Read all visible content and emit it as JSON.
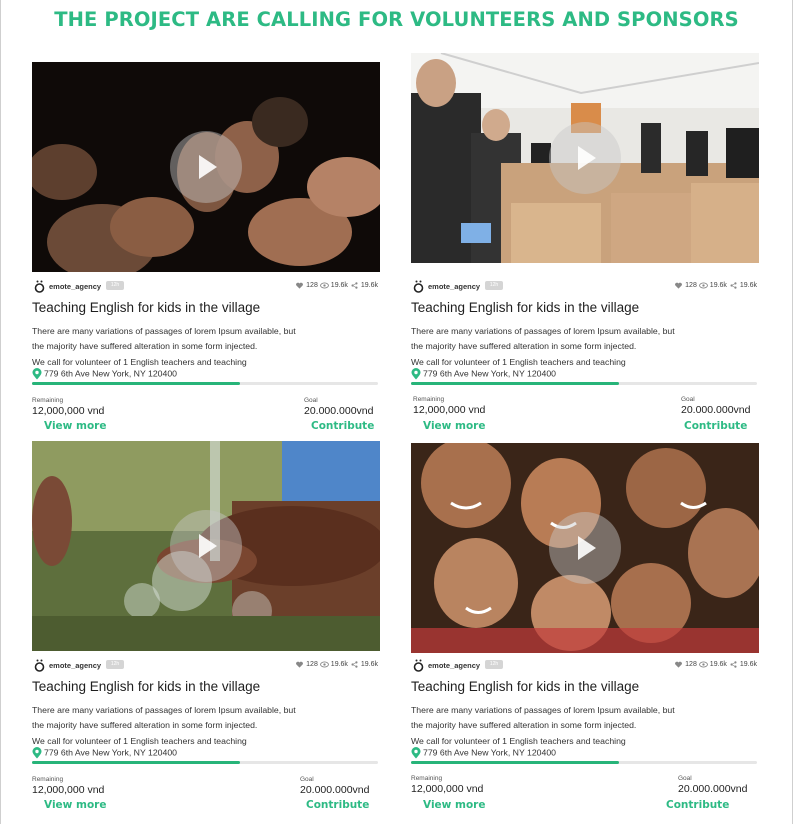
{
  "page": {
    "title": "THE PROJECT ARE CALLING FOR VOLUNTEERS AND SPONSORS"
  },
  "cards": [
    {
      "image": "cupped-hands-photo",
      "agency": "emote_agency",
      "tag": "12h",
      "likes": "128",
      "views": "19.6k",
      "shares": "19.6k",
      "title": "Teaching English for kids in the village",
      "desc_1": "There are many variations of passages of lorem Ipsum available, but",
      "desc_2": "the majority have suffered alteration in some form injected.",
      "desc_3": "We call for volunteer of 1 English teachers and teaching",
      "address": "779 6th Ave New York, NY 120400",
      "progress": 0.6,
      "remaining_label": "Remaining",
      "remaining_value": "12,000,000 vnd",
      "goal_label": "Goal",
      "goal_value": "20.000.000vnd",
      "view_more": "View more",
      "contribute": "Contribute"
    },
    {
      "image": "volunteers-packing-boxes-photo",
      "agency": "emote_agency",
      "tag": "12h",
      "likes": "128",
      "views": "19.6k",
      "shares": "19.6k",
      "title": "Teaching English for kids in the village",
      "desc_1": "There are many variations of passages of lorem Ipsum available, but",
      "desc_2": "the majority have suffered alteration in some form injected.",
      "desc_3": "We call for volunteer of 1 English teachers and teaching",
      "address": "779 6th Ave New York, NY 120400",
      "progress": 0.6,
      "remaining_label": "Remaining",
      "remaining_value": "12,000,000 vnd",
      "goal_label": "Goal",
      "goal_value": "20.000.000vnd",
      "view_more": "View more",
      "contribute": "Contribute"
    },
    {
      "image": "water-splash-hands-photo",
      "agency": "emote_agency",
      "tag": "12h",
      "likes": "128",
      "views": "19.6k",
      "shares": "19.6k",
      "title": "Teaching English for kids in the village",
      "desc_1": "There are many variations of passages of lorem Ipsum available, but",
      "desc_2": "the majority have suffered alteration in some form injected.",
      "desc_3": "We call for volunteer of 1 English teachers and teaching",
      "address": "779 6th Ave New York, NY 120400",
      "progress": 0.6,
      "remaining_label": "Remaining",
      "remaining_value": "12,000,000 vnd",
      "goal_label": "Goal",
      "goal_value": "20.000.000vnd",
      "view_more": "View more",
      "contribute": "Contribute"
    },
    {
      "image": "smiling-children-photo",
      "agency": "emote_agency",
      "tag": "12h",
      "likes": "128",
      "views": "19.6k",
      "shares": "19.6k",
      "title": "Teaching English for kids in the village",
      "desc_1": "There are many variations of passages of lorem Ipsum available, but",
      "desc_2": "the majority have suffered alteration in some form injected.",
      "desc_3": "We call for volunteer of 1 English teachers and teaching",
      "address": "779 6th Ave New York, NY 120400",
      "progress": 0.6,
      "remaining_label": "Remaining",
      "remaining_value": "12,000,000 vnd",
      "goal_label": "Goal",
      "goal_value": "20.000.000vnd",
      "view_more": "View more",
      "contribute": "Contribute"
    }
  ],
  "colors": {
    "accent": "#2dba84",
    "progress": "#27b479",
    "track": "#e6e6e6"
  }
}
